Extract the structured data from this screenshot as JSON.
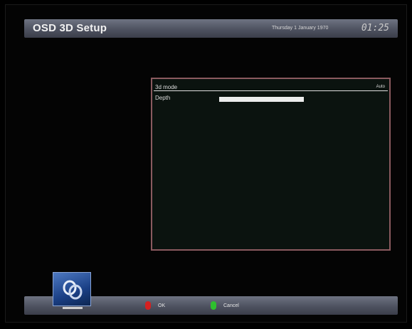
{
  "header": {
    "title": "OSD 3D Setup",
    "date": "Thursday 1 January 1970",
    "time": "01:25"
  },
  "menu": {
    "items": [
      {
        "label": "3d mode",
        "value": "Auto"
      },
      {
        "label": "Depth",
        "value": ""
      }
    ],
    "depth_level": 1.0
  },
  "footer": {
    "ok_label": "OK",
    "cancel_label": "Cancel",
    "ok_color": "#d62020",
    "cancel_color": "#2ec02e"
  },
  "logo": {
    "icon": "3d-logo-icon"
  }
}
